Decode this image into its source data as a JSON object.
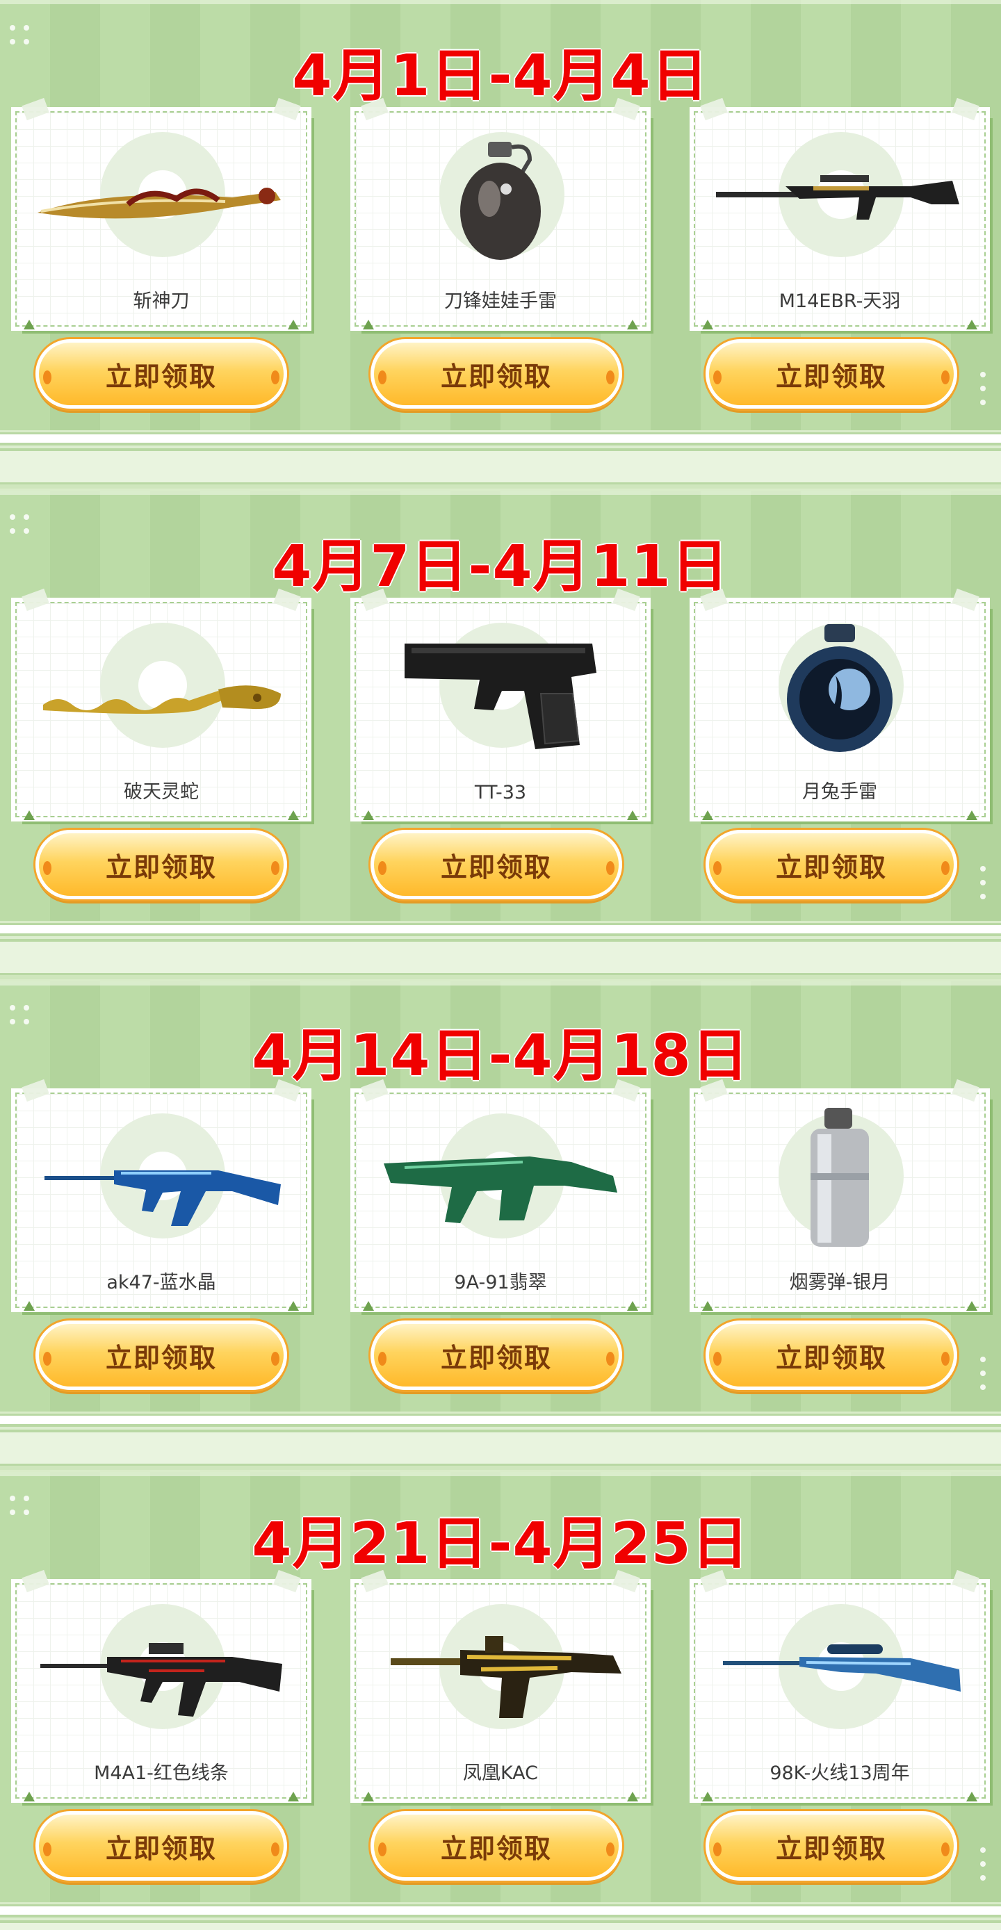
{
  "sections": [
    {
      "title": "4月1日-4月4日",
      "items": [
        {
          "name": "斩神刀",
          "icon": "blade-icon",
          "button": "立即领取"
        },
        {
          "name": "刀锋娃娃手雷",
          "icon": "grenade-icon",
          "button": "立即领取"
        },
        {
          "name": "M14EBR-天羽",
          "icon": "rifle-icon",
          "button": "立即领取"
        }
      ]
    },
    {
      "title": "4月7日-4月11日",
      "items": [
        {
          "name": "破天灵蛇",
          "icon": "serpent-blade-icon",
          "button": "立即领取"
        },
        {
          "name": "TT-33",
          "icon": "pistol-icon",
          "button": "立即领取"
        },
        {
          "name": "月兔手雷",
          "icon": "moon-grenade-icon",
          "button": "立即领取"
        }
      ]
    },
    {
      "title": "4月14日-4月18日",
      "items": [
        {
          "name": "ak47-蓝水晶",
          "icon": "ak47-icon",
          "button": "立即领取"
        },
        {
          "name": "9A-91翡翠",
          "icon": "smg-icon",
          "button": "立即领取"
        },
        {
          "name": "烟雾弹-银月",
          "icon": "smoke-grenade-icon",
          "button": "立即领取"
        }
      ]
    },
    {
      "title": "4月21日-4月25日",
      "items": [
        {
          "name": "M4A1-红色线条",
          "icon": "m4a1-icon",
          "button": "立即领取"
        },
        {
          "name": "凤凰KAC",
          "icon": "machine-gun-icon",
          "button": "立即领取"
        },
        {
          "name": "98K-火线13周年",
          "icon": "sniper-rifle-icon",
          "button": "立即领取"
        }
      ]
    }
  ]
}
